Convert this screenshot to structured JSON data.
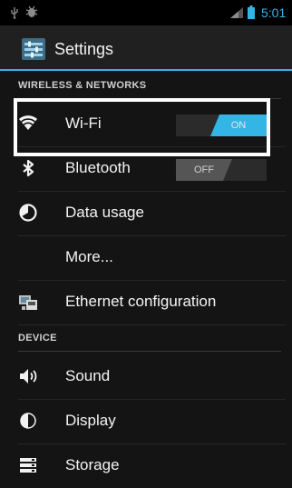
{
  "status_bar": {
    "time": "5:01",
    "icons": [
      "usb-icon",
      "debug-icon",
      "signal-icon",
      "battery-icon"
    ],
    "accent_color": "#33b5e5"
  },
  "action_bar": {
    "title": "Settings",
    "icon": "settings-icon"
  },
  "sections": {
    "wireless": {
      "header": "WIRELESS & NETWORKS",
      "items": [
        {
          "label": "Wi-Fi",
          "icon": "wifi-icon",
          "toggle": "ON"
        },
        {
          "label": "Bluetooth",
          "icon": "bluetooth-icon",
          "toggle": "OFF"
        },
        {
          "label": "Data usage",
          "icon": "data-usage-icon"
        },
        {
          "label": "More..."
        },
        {
          "label": "Ethernet configuration",
          "icon": "ethernet-icon"
        }
      ]
    },
    "device": {
      "header": "DEVICE",
      "items": [
        {
          "label": "Sound",
          "icon": "sound-icon"
        },
        {
          "label": "Display",
          "icon": "display-icon"
        },
        {
          "label": "Storage",
          "icon": "storage-icon"
        }
      ]
    }
  },
  "highlight_color": "#ffffff"
}
